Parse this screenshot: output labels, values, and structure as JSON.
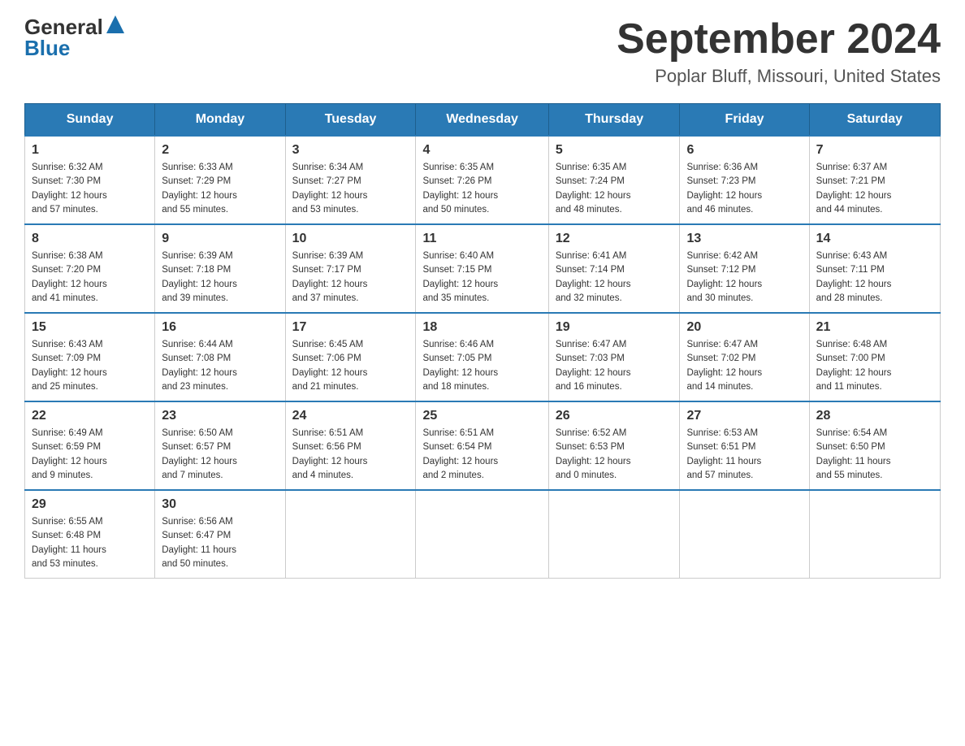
{
  "logo": {
    "general": "General",
    "blue": "Blue"
  },
  "title": "September 2024",
  "location": "Poplar Bluff, Missouri, United States",
  "headers": [
    "Sunday",
    "Monday",
    "Tuesday",
    "Wednesday",
    "Thursday",
    "Friday",
    "Saturday"
  ],
  "weeks": [
    [
      {
        "day": "1",
        "sunrise": "6:32 AM",
        "sunset": "7:30 PM",
        "daylight": "12 hours and 57 minutes."
      },
      {
        "day": "2",
        "sunrise": "6:33 AM",
        "sunset": "7:29 PM",
        "daylight": "12 hours and 55 minutes."
      },
      {
        "day": "3",
        "sunrise": "6:34 AM",
        "sunset": "7:27 PM",
        "daylight": "12 hours and 53 minutes."
      },
      {
        "day": "4",
        "sunrise": "6:35 AM",
        "sunset": "7:26 PM",
        "daylight": "12 hours and 50 minutes."
      },
      {
        "day": "5",
        "sunrise": "6:35 AM",
        "sunset": "7:24 PM",
        "daylight": "12 hours and 48 minutes."
      },
      {
        "day": "6",
        "sunrise": "6:36 AM",
        "sunset": "7:23 PM",
        "daylight": "12 hours and 46 minutes."
      },
      {
        "day": "7",
        "sunrise": "6:37 AM",
        "sunset": "7:21 PM",
        "daylight": "12 hours and 44 minutes."
      }
    ],
    [
      {
        "day": "8",
        "sunrise": "6:38 AM",
        "sunset": "7:20 PM",
        "daylight": "12 hours and 41 minutes."
      },
      {
        "day": "9",
        "sunrise": "6:39 AM",
        "sunset": "7:18 PM",
        "daylight": "12 hours and 39 minutes."
      },
      {
        "day": "10",
        "sunrise": "6:39 AM",
        "sunset": "7:17 PM",
        "daylight": "12 hours and 37 minutes."
      },
      {
        "day": "11",
        "sunrise": "6:40 AM",
        "sunset": "7:15 PM",
        "daylight": "12 hours and 35 minutes."
      },
      {
        "day": "12",
        "sunrise": "6:41 AM",
        "sunset": "7:14 PM",
        "daylight": "12 hours and 32 minutes."
      },
      {
        "day": "13",
        "sunrise": "6:42 AM",
        "sunset": "7:12 PM",
        "daylight": "12 hours and 30 minutes."
      },
      {
        "day": "14",
        "sunrise": "6:43 AM",
        "sunset": "7:11 PM",
        "daylight": "12 hours and 28 minutes."
      }
    ],
    [
      {
        "day": "15",
        "sunrise": "6:43 AM",
        "sunset": "7:09 PM",
        "daylight": "12 hours and 25 minutes."
      },
      {
        "day": "16",
        "sunrise": "6:44 AM",
        "sunset": "7:08 PM",
        "daylight": "12 hours and 23 minutes."
      },
      {
        "day": "17",
        "sunrise": "6:45 AM",
        "sunset": "7:06 PM",
        "daylight": "12 hours and 21 minutes."
      },
      {
        "day": "18",
        "sunrise": "6:46 AM",
        "sunset": "7:05 PM",
        "daylight": "12 hours and 18 minutes."
      },
      {
        "day": "19",
        "sunrise": "6:47 AM",
        "sunset": "7:03 PM",
        "daylight": "12 hours and 16 minutes."
      },
      {
        "day": "20",
        "sunrise": "6:47 AM",
        "sunset": "7:02 PM",
        "daylight": "12 hours and 14 minutes."
      },
      {
        "day": "21",
        "sunrise": "6:48 AM",
        "sunset": "7:00 PM",
        "daylight": "12 hours and 11 minutes."
      }
    ],
    [
      {
        "day": "22",
        "sunrise": "6:49 AM",
        "sunset": "6:59 PM",
        "daylight": "12 hours and 9 minutes."
      },
      {
        "day": "23",
        "sunrise": "6:50 AM",
        "sunset": "6:57 PM",
        "daylight": "12 hours and 7 minutes."
      },
      {
        "day": "24",
        "sunrise": "6:51 AM",
        "sunset": "6:56 PM",
        "daylight": "12 hours and 4 minutes."
      },
      {
        "day": "25",
        "sunrise": "6:51 AM",
        "sunset": "6:54 PM",
        "daylight": "12 hours and 2 minutes."
      },
      {
        "day": "26",
        "sunrise": "6:52 AM",
        "sunset": "6:53 PM",
        "daylight": "12 hours and 0 minutes."
      },
      {
        "day": "27",
        "sunrise": "6:53 AM",
        "sunset": "6:51 PM",
        "daylight": "11 hours and 57 minutes."
      },
      {
        "day": "28",
        "sunrise": "6:54 AM",
        "sunset": "6:50 PM",
        "daylight": "11 hours and 55 minutes."
      }
    ],
    [
      {
        "day": "29",
        "sunrise": "6:55 AM",
        "sunset": "6:48 PM",
        "daylight": "11 hours and 53 minutes."
      },
      {
        "day": "30",
        "sunrise": "6:56 AM",
        "sunset": "6:47 PM",
        "daylight": "11 hours and 50 minutes."
      },
      null,
      null,
      null,
      null,
      null
    ]
  ],
  "labels": {
    "sunrise": "Sunrise:",
    "sunset": "Sunset:",
    "daylight": "Daylight:"
  }
}
